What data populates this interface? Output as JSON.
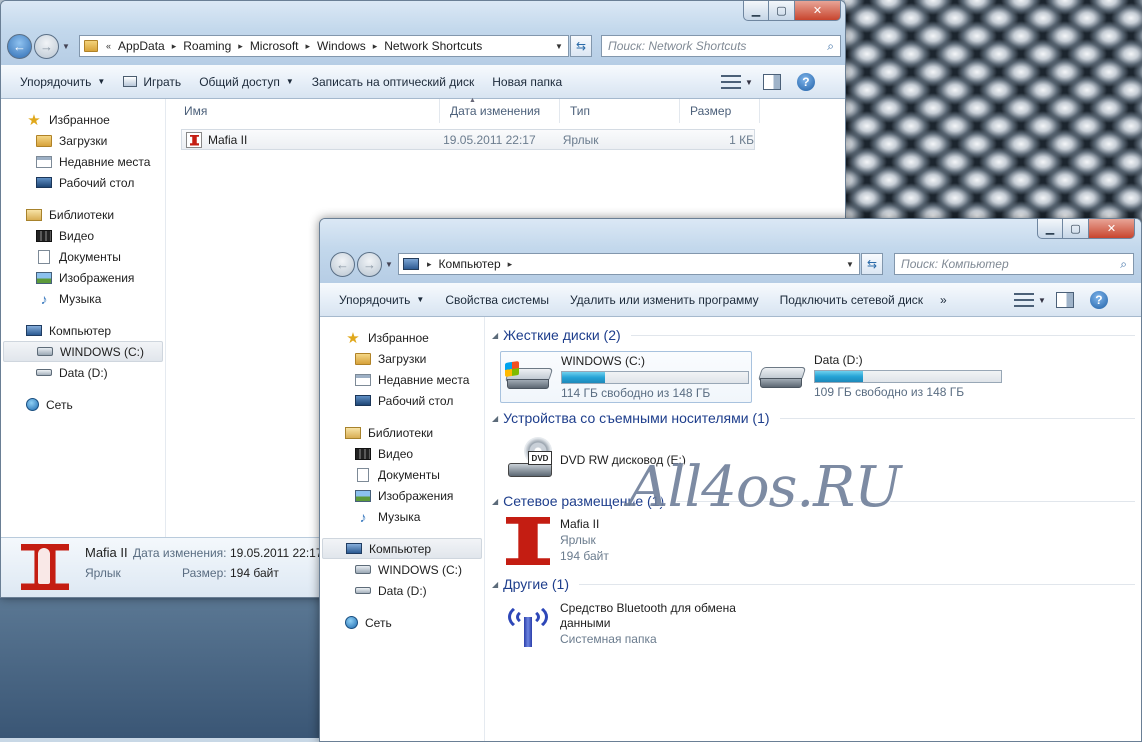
{
  "back_window": {
    "path": [
      "AppData",
      "Roaming",
      "Microsoft",
      "Windows",
      "Network Shortcuts"
    ],
    "path_overflow": "«",
    "search_placeholder": "Поиск: Network Shortcuts",
    "commands": {
      "organize": "Упорядочить",
      "play": "Играть",
      "share": "Общий доступ",
      "burn": "Записать на оптический диск",
      "new_folder": "Новая папка"
    },
    "columns": {
      "name": "Имя",
      "date": "Дата изменения",
      "type": "Тип",
      "size": "Размер"
    },
    "nav": {
      "favorites": "Избранное",
      "downloads": "Загрузки",
      "recent": "Недавние места",
      "desktop": "Рабочий стол",
      "libraries": "Библиотеки",
      "video": "Видео",
      "documents": "Документы",
      "images": "Изображения",
      "music": "Музыка",
      "computer": "Компьютер",
      "drive_c": "WINDOWS (C:)",
      "drive_d": "Data (D:)",
      "network": "Сеть"
    },
    "files": [
      {
        "name": "Mafia II",
        "date": "19.05.2011 22:17",
        "type": "Ярлык",
        "size": "1 КБ"
      }
    ],
    "details": {
      "name": "Mafia II",
      "date_label": "Дата изменения:",
      "date": "19.05.2011 22:17",
      "type": "Ярлык",
      "size_label": "Размер:",
      "size": "194 байт"
    }
  },
  "front_window": {
    "path": [
      "Компьютер"
    ],
    "search_placeholder": "Поиск: Компьютер",
    "commands": {
      "organize": "Упорядочить",
      "system_props": "Свойства системы",
      "uninstall": "Удалить или изменить программу",
      "map_drive": "Подключить сетевой диск",
      "more": "»"
    },
    "nav": {
      "favorites": "Избранное",
      "downloads": "Загрузки",
      "recent": "Недавние места",
      "desktop": "Рабочий стол",
      "libraries": "Библиотеки",
      "video": "Видео",
      "documents": "Документы",
      "images": "Изображения",
      "music": "Музыка",
      "computer": "Компьютер",
      "drive_c": "WINDOWS (C:)",
      "drive_d": "Data (D:)",
      "network": "Сеть"
    },
    "groups": {
      "hdd": "Жесткие диски (2)",
      "removable": "Устройства со съемными носителями (1)",
      "network": "Сетевое размещение (1)",
      "other": "Другие (1)"
    },
    "drives": [
      {
        "name": "WINDOWS (C:)",
        "free": "114 ГБ свободно из 148 ГБ",
        "used_fraction": 0.23
      },
      {
        "name": "Data (D:)",
        "free": "109 ГБ свободно из 148 ГБ",
        "used_fraction": 0.26
      }
    ],
    "dvd": {
      "name": "DVD RW дисковод (E:)",
      "badge": "DVD"
    },
    "network_item": {
      "name": "Mafia II",
      "type": "Ярлык",
      "size": "194 байт"
    },
    "other_item": {
      "name_line1": "Средство Bluetooth для обмена",
      "name_line2": "данными",
      "type": "Системная папка"
    }
  },
  "watermark": "All4os.RU",
  "colors": {
    "progress": "#26a3d6",
    "group_title": "#1e3e8c",
    "close_button": "#c8452e"
  }
}
